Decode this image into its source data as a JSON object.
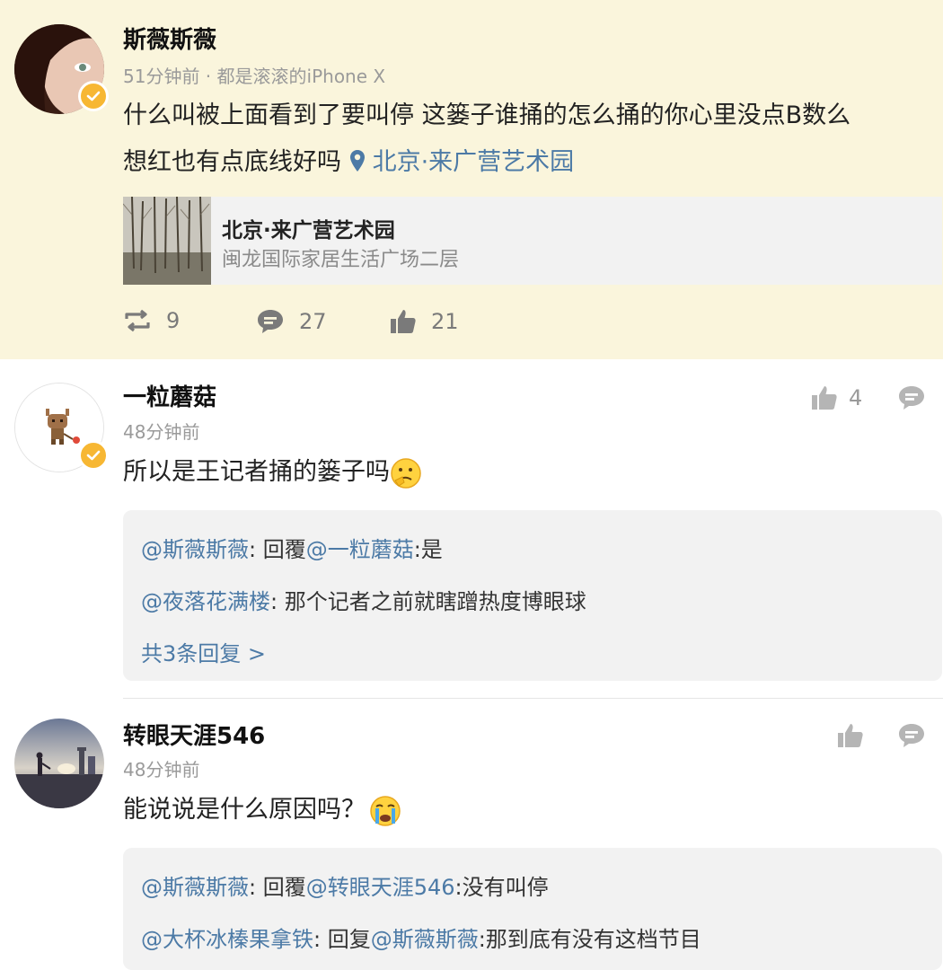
{
  "post": {
    "author": "斯薇斯薇",
    "time": "51分钟前",
    "separator": " · ",
    "source": "都是滚滚的iPhone X",
    "text_line1": "什么叫被上面看到了要叫停 这篓子谁捅的怎么捅的你心里没点B数么",
    "text_line2": "想红也有点底线好吗 ",
    "location_link": "北京·来广营艺术园",
    "location_card": {
      "title": "北京·来广营艺术园",
      "address": "闽龙国际家居生活广场二层"
    },
    "reposts": "9",
    "comments": "27",
    "likes": "21"
  },
  "comments": [
    {
      "author": "一粒蘑菇",
      "time": "48分钟前",
      "text": "所以是王记者捅的篓子吗",
      "likes": "4",
      "replies": [
        {
          "at": "@斯薇斯薇",
          "sep": ": 回覆",
          "at2": "@一粒蘑菇",
          "rest": ":是"
        },
        {
          "at": "@夜落花满楼",
          "sep": ": 那个记者之前就瞎蹭热度博眼球",
          "at2": "",
          "rest": ""
        }
      ],
      "more": "共3条回复 >"
    },
    {
      "author": "转眼天涯546",
      "time": "48分钟前",
      "text": "能说说是什么原因吗？",
      "likes": "",
      "replies": [
        {
          "at": "@斯薇斯薇",
          "sep": ": 回覆",
          "at2": "@转眼天涯546",
          "rest": ":没有叫停"
        },
        {
          "at": "@大杯冰榛果拿铁",
          "sep": ": 回复",
          "at2": "@斯薇斯薇",
          "rest": ":那到底有没有这档节目"
        }
      ]
    }
  ],
  "colors": {
    "post_bg": "#faf5dc",
    "link": "#4c7aa6",
    "verified": "#f7b733"
  }
}
